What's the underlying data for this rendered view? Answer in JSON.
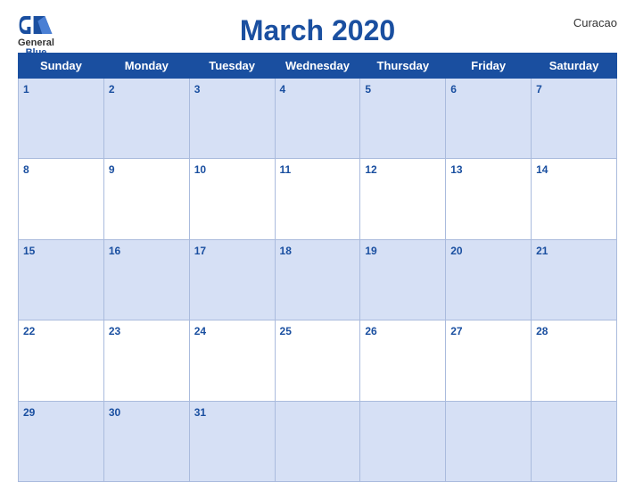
{
  "header": {
    "title": "March 2020",
    "country": "Curacao",
    "logo_general": "General",
    "logo_blue": "Blue"
  },
  "weekdays": [
    "Sunday",
    "Monday",
    "Tuesday",
    "Wednesday",
    "Thursday",
    "Friday",
    "Saturday"
  ],
  "weeks": [
    [
      1,
      2,
      3,
      4,
      5,
      6,
      7
    ],
    [
      8,
      9,
      10,
      11,
      12,
      13,
      14
    ],
    [
      15,
      16,
      17,
      18,
      19,
      20,
      21
    ],
    [
      22,
      23,
      24,
      25,
      26,
      27,
      28
    ],
    [
      29,
      30,
      31,
      null,
      null,
      null,
      null
    ]
  ]
}
